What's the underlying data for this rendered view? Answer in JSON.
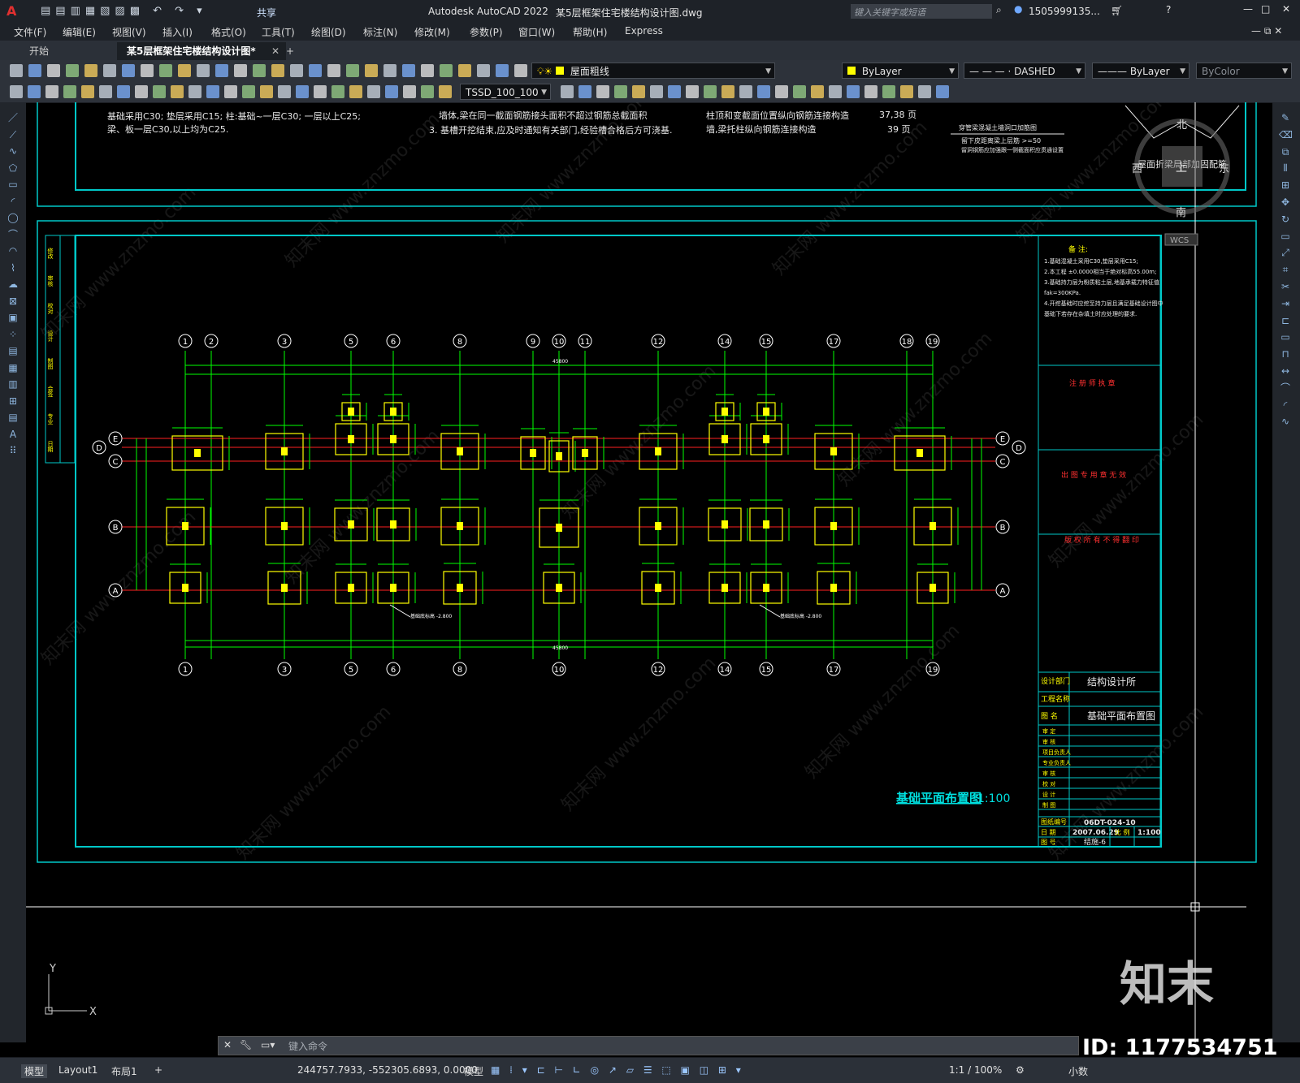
{
  "titlebar": {
    "app_title": "Autodesk AutoCAD 2022",
    "file_title": "某5层框架住宅楼结构设计图.dwg",
    "share_label": "共享",
    "search_placeholder": "键入关键字或短语",
    "user": "1505999135...",
    "logo": "A"
  },
  "menu": [
    "文件(F)",
    "编辑(E)",
    "视图(V)",
    "插入(I)",
    "格式(O)",
    "工具(T)",
    "绘图(D)",
    "标注(N)",
    "修改(M)",
    "参数(P)",
    "窗口(W)",
    "帮助(H)",
    "Express"
  ],
  "tabs": {
    "start": "开始",
    "doc": "某5层框架住宅楼结构设计图*",
    "add": "+"
  },
  "toolbar": {
    "layer": "屋面粗线",
    "color": "ByLayer",
    "linetype": "DASHED",
    "lineweight": "ByLayer",
    "plotstyle": "ByColor",
    "dimstyle": "TSSD_100_100"
  },
  "drawing": {
    "top_notes_left_1": "基础采用C30; 垫层采用C15; 柱:基础~一层C30; 一层以上C25;",
    "top_notes_left_2": "梁、板一层C30,以上均为C25.",
    "top_notes_mid_1": "墙体,梁在同一截面钢筋接头面积不超过钢筋总截面积",
    "top_notes_mid_2": "3. 基槽开挖结束,应及时通知有关部门,经验槽合格后方可浇基.",
    "top_notes_right_1": "柱顶和变截面位置纵向钢筋连接构造",
    "top_notes_right_2": "墙,梁托柱纵向钢筋连接构造",
    "page_ref_1": "37,38 页",
    "page_ref_2": "39 页",
    "detail_title": "穿管梁混凝土墙洞口加筋图",
    "detail_note_1": "留下皮距离梁上层筋 >=50",
    "detail_note_2": "留洞钢筋应加强跟一侧截面积应贯通设置",
    "roof_detail_label": "屋面折梁局部加固配筋",
    "notes_title": "备 注:",
    "notes": [
      "1.基础混凝土采用C30,垫层采用C15;",
      "2.本工程 ±0.0000相当于绝对标高55.00m;",
      "3.基础持力层为粉质粘土层,地基承载力特征值",
      "   fak=300KPa.",
      "4.开挖基础时应挖至持力层且满足基础设计图中",
      "   基础下若存在杂填土时应处理的要求."
    ],
    "stamp_1": "注 册 师 执 章",
    "stamp_2": "出 图 专 用 章 无 效",
    "stamp_3": "版 权 所 有 不 得 翻 印",
    "tb_office_label": "设计部门",
    "tb_office": "结构设计所",
    "tb_project_label": "工程名称",
    "tb_drawing_label": "图 名",
    "tb_drawing": "基础平面布置图",
    "tb_rows": [
      "审 定",
      "审 核",
      "项目负责人",
      "专业负责人",
      "审 核",
      "校 对",
      "设 计",
      "制 图"
    ],
    "tb_number_label": "图纸编号",
    "tb_number": "06DT-024-10",
    "tb_date_label": "日 期",
    "tb_date": "2007.06.29",
    "tb_scale_label": "比 例",
    "tb_scale": "1:100",
    "tb_sheet_label": "图 号",
    "tb_sheet": "结施-6",
    "plan_title": "基础平面布置图",
    "plan_scale": "1:100",
    "axes_top": [
      "1",
      "2",
      "3",
      "5",
      "6",
      "8",
      "9",
      "10",
      "11",
      "12",
      "14",
      "15",
      "17",
      "18",
      "19"
    ],
    "axes_bottom": [
      "1",
      "3",
      "5",
      "6",
      "8",
      "10",
      "12",
      "14",
      "15",
      "17",
      "19"
    ],
    "axes_rows": [
      "E",
      "D",
      "C",
      "B",
      "A"
    ],
    "total_dim": "45800",
    "elev_note": "基础底标高 -2.800",
    "left_strip": [
      "修改",
      "审核",
      "校对",
      "设计",
      "制图",
      "会签",
      "专业",
      "日期"
    ]
  },
  "viewcube": {
    "north": "北",
    "south": "南",
    "east": "东",
    "west": "西",
    "center": "上",
    "wcs": "WCS"
  },
  "ucs": {
    "x": "X",
    "y": "Y"
  },
  "command": {
    "placeholder": "键入命令"
  },
  "status": {
    "model_tab": "模型",
    "layout1": "Layout1",
    "layout2": "布局1",
    "coords": "244757.7933, -552305.6893, 0.0000",
    "model": "模型",
    "scale": "1:1 / 100%",
    "units": "小数"
  },
  "watermark": {
    "brand": "知末",
    "id": "ID: 1177534751",
    "site": "www.znzmo.com",
    "site_cn": "知末网"
  },
  "colors": {
    "cyan": "#00e0e0",
    "green": "#00ff00",
    "yellow": "#ffff00",
    "red": "#ff2020",
    "white": "#ffffff"
  }
}
